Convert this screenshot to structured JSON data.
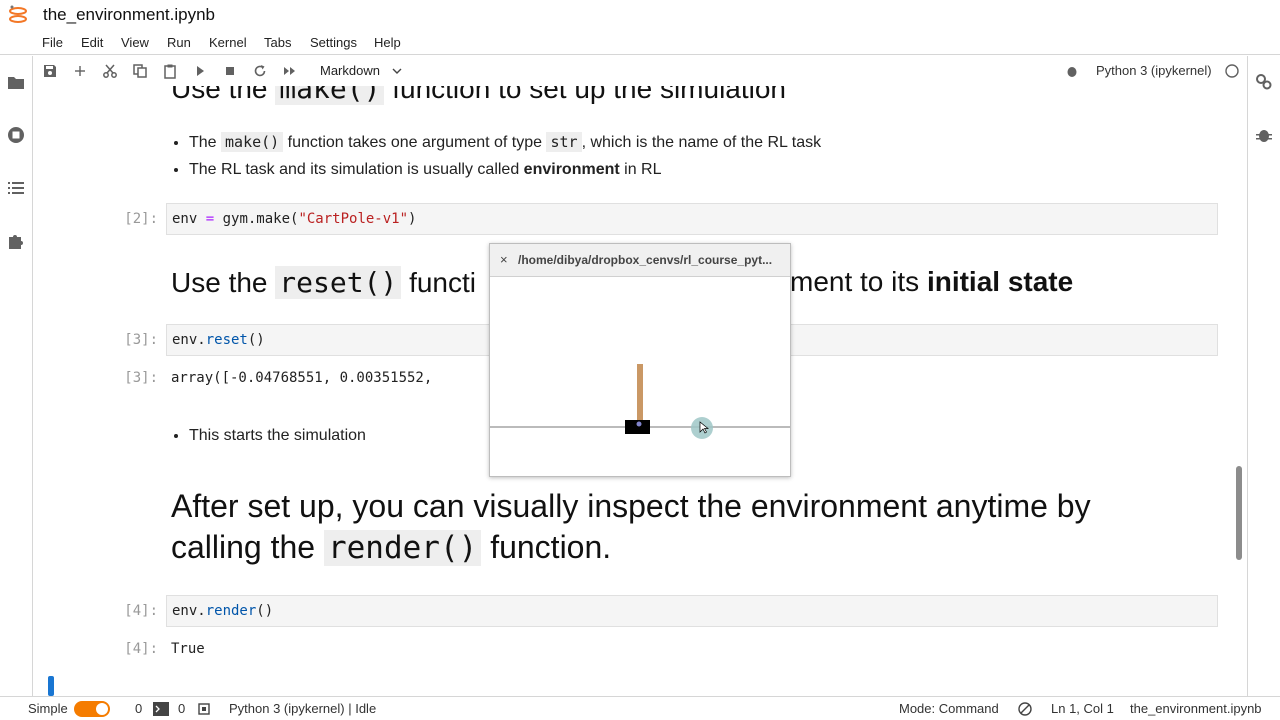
{
  "app": {
    "doc_title": "the_environment.ipynb"
  },
  "menu": [
    "File",
    "Edit",
    "View",
    "Run",
    "Kernel",
    "Tabs",
    "Settings",
    "Help"
  ],
  "toolbar": {
    "cell_type": "Markdown",
    "kernel": "Python 3 (ipykernel)"
  },
  "notebook": {
    "heading_top": {
      "pre": "Use the ",
      "code": "make()",
      "post": " function to set up the simulation"
    },
    "bullets_1": [
      {
        "a": "The ",
        "code": "make()",
        "b": " function takes one argument of type ",
        "code2": "str",
        "c": ", which is the name of the RL task"
      },
      {
        "a": "The RL task and its simulation is usually called ",
        "bold": "environment",
        "c": " in RL"
      }
    ],
    "cell2": {
      "prompt": "[2]:",
      "code_var": "env",
      "code_eq": " = ",
      "code_call": "gym.make(",
      "code_str": "\"CartPole-v1\"",
      "code_end": ")"
    },
    "heading_reset": {
      "pre": "Use the ",
      "code": "reset()",
      "mid": " functi",
      "hidden_tail": "ment to its ",
      "bold": "initial state"
    },
    "cell3": {
      "prompt": "[3]:",
      "code_var": "env.",
      "code_fn": "reset",
      "code_end": "()"
    },
    "out3": {
      "prompt": "[3]:",
      "text": "array([-0.04768551,  0.00351552,"
    },
    "bullet_sim": "This starts the simulation",
    "heading_big": {
      "line1": "After set up, you can visually inspect the environment anytime by",
      "pre": "calling the ",
      "code": "render()",
      "post": " function."
    },
    "cell4": {
      "prompt": "[4]:",
      "code_var": "env.",
      "code_fn": "render",
      "code_end": "()"
    },
    "out4": {
      "prompt": "[4]:",
      "text": "True"
    }
  },
  "render_window": {
    "title": "/home/dibya/dropbox_cenvs/rl_course_pyt...",
    "close": "×"
  },
  "status": {
    "mode_simple": "Simple",
    "count_a": "0",
    "count_b": "0",
    "kernel_state": "Python 3 (ipykernel) | Idle",
    "mode": "Mode: Command",
    "cursor": "Ln 1, Col 1",
    "file": "the_environment.ipynb"
  },
  "colors": {
    "accent": "#f57c00",
    "active": "#1976d2",
    "cart": "#000000",
    "pole": "#ca9865",
    "axle": "#8184cb"
  }
}
